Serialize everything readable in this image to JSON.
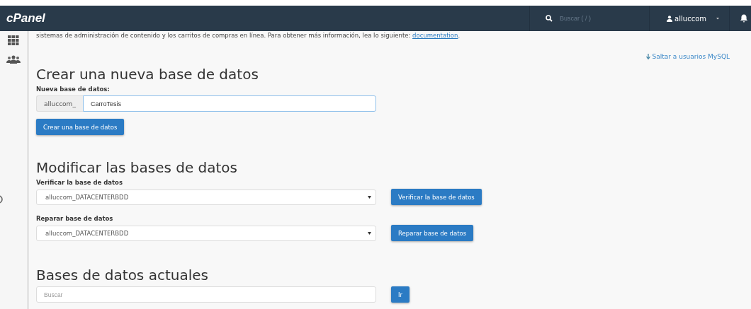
{
  "navbar": {
    "logo": "cPanel",
    "search": {
      "placeholder": "Buscar ( / )"
    },
    "user": "alluccom"
  },
  "intro": {
    "text": "sistemas de administración de contenido y los carritos de compras en línea. Para obtener más información, lea lo siguiente:",
    "link": "documentation",
    "after": "."
  },
  "jump_link": "Saltar a usuarios MySQL",
  "create": {
    "heading": "Crear una nueva base de datos",
    "label": "Nueva base de datos:",
    "prefix": "alluccom_",
    "value": "CarroTesis",
    "button": "Crear una base de datos"
  },
  "modify": {
    "heading": "Modificar las bases de datos",
    "rows": [
      {
        "label": "Verificar la base de datos",
        "value": "alluccom_DATACENTERBDD",
        "button": "Verificar la base de datos"
      },
      {
        "label": "Reparar base de datos",
        "value": "alluccom_DATACENTERBDD",
        "button": "Reparar base de datos"
      }
    ]
  },
  "current": {
    "heading": "Bases de datos actuales",
    "search": {
      "placeholder": "Buscar"
    },
    "button": "Ir"
  }
}
